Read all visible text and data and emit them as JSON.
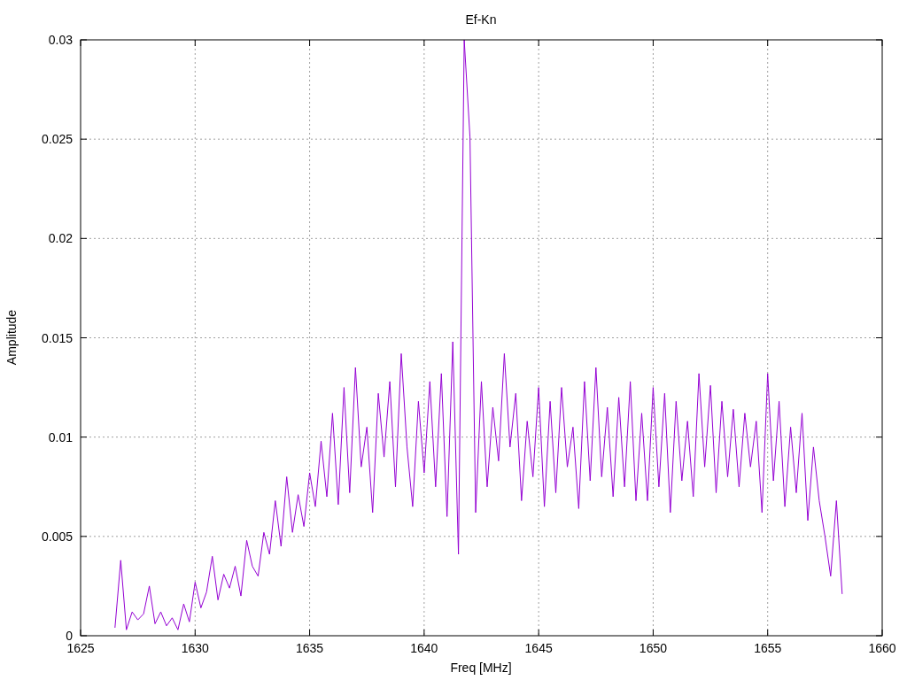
{
  "chart_data": {
    "type": "line",
    "title": "Ef-Kn",
    "xlabel": "Freq [MHz]",
    "ylabel": "Amplitude",
    "xlim": [
      1625,
      1660
    ],
    "ylim": [
      0,
      0.03
    ],
    "xticks": [
      1625,
      1630,
      1635,
      1640,
      1645,
      1650,
      1655,
      1660
    ],
    "yticks": [
      0,
      0.005,
      0.01,
      0.015,
      0.02,
      0.025,
      0.03
    ],
    "x": [
      1626.5,
      1626.75,
      1627,
      1627.25,
      1627.5,
      1627.75,
      1628,
      1628.25,
      1628.5,
      1628.75,
      1629,
      1629.25,
      1629.5,
      1629.75,
      1630,
      1630.25,
      1630.5,
      1630.75,
      1631,
      1631.25,
      1631.5,
      1631.75,
      1632,
      1632.25,
      1632.5,
      1632.75,
      1633,
      1633.25,
      1633.5,
      1633.75,
      1634,
      1634.25,
      1634.5,
      1634.75,
      1635,
      1635.25,
      1635.5,
      1635.75,
      1636,
      1636.25,
      1636.5,
      1636.75,
      1637,
      1637.25,
      1637.5,
      1637.75,
      1638,
      1638.25,
      1638.5,
      1638.75,
      1639,
      1639.25,
      1639.5,
      1639.75,
      1640,
      1640.25,
      1640.5,
      1640.75,
      1641,
      1641.25,
      1641.5,
      1641.75,
      1642,
      1642.25,
      1642.5,
      1642.75,
      1643,
      1643.25,
      1643.5,
      1643.75,
      1644,
      1644.25,
      1644.5,
      1644.75,
      1645,
      1645.25,
      1645.5,
      1645.75,
      1646,
      1646.25,
      1646.5,
      1646.75,
      1647,
      1647.25,
      1647.5,
      1647.75,
      1648,
      1648.25,
      1648.5,
      1648.75,
      1649,
      1649.25,
      1649.5,
      1649.75,
      1650,
      1650.25,
      1650.5,
      1650.75,
      1651,
      1651.25,
      1651.5,
      1651.75,
      1652,
      1652.25,
      1652.5,
      1652.75,
      1653,
      1653.25,
      1653.5,
      1653.75,
      1654,
      1654.25,
      1654.5,
      1654.75,
      1655,
      1655.25,
      1655.5,
      1655.75,
      1656,
      1656.25,
      1656.5,
      1656.75,
      1657,
      1657.25,
      1657.5,
      1657.75,
      1658,
      1658.25
    ],
    "grid": true,
    "series": [
      {
        "color": "#9400d3",
        "values": [
          0.0004,
          0.0038,
          0.0003,
          0.0012,
          0.0008,
          0.0011,
          0.0025,
          0.0006,
          0.0012,
          0.0005,
          0.0009,
          0.0003,
          0.0016,
          0.0007,
          0.0027,
          0.0014,
          0.0022,
          0.004,
          0.0018,
          0.0031,
          0.0024,
          0.0035,
          0.002,
          0.0048,
          0.0035,
          0.003,
          0.0052,
          0.0041,
          0.0068,
          0.0045,
          0.008,
          0.0052,
          0.0071,
          0.0055,
          0.0082,
          0.0065,
          0.0098,
          0.007,
          0.0112,
          0.0066,
          0.0125,
          0.0072,
          0.0135,
          0.0085,
          0.0105,
          0.0062,
          0.0122,
          0.009,
          0.0128,
          0.0075,
          0.0142,
          0.0095,
          0.0065,
          0.0118,
          0.0082,
          0.0128,
          0.0075,
          0.0132,
          0.006,
          0.0148,
          0.0041,
          0.03,
          0.0251,
          0.0062,
          0.0128,
          0.0075,
          0.0115,
          0.0088,
          0.0142,
          0.0095,
          0.0122,
          0.0068,
          0.0108,
          0.008,
          0.0125,
          0.0065,
          0.0118,
          0.0072,
          0.0125,
          0.0085,
          0.0105,
          0.0064,
          0.0128,
          0.0078,
          0.0135,
          0.008,
          0.0115,
          0.007,
          0.012,
          0.0075,
          0.0128,
          0.0068,
          0.0112,
          0.0068,
          0.0125,
          0.0075,
          0.0122,
          0.0062,
          0.0118,
          0.0078,
          0.0108,
          0.007,
          0.0132,
          0.0085,
          0.0126,
          0.0072,
          0.0118,
          0.008,
          0.0114,
          0.0075,
          0.0112,
          0.0085,
          0.0108,
          0.0062,
          0.0132,
          0.0078,
          0.0118,
          0.0065,
          0.0105,
          0.0072,
          0.0112,
          0.0058,
          0.0095,
          0.0068,
          0.005,
          0.003,
          0.0068,
          0.0021
        ]
      }
    ]
  }
}
